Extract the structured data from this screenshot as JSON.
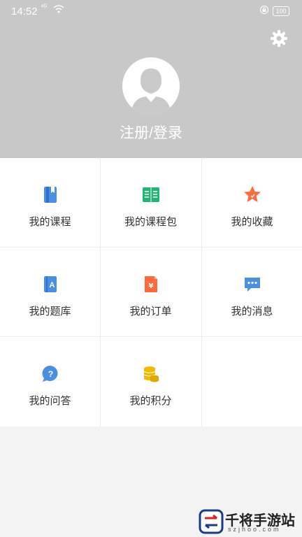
{
  "status": {
    "time": "14:52",
    "network": "⁴ᴳ",
    "battery": "100"
  },
  "header": {
    "login_text": "注册/登录"
  },
  "menu": [
    {
      "label": "我的课程",
      "icon": "book-icon",
      "color": "#4a90e2"
    },
    {
      "label": "我的课程包",
      "icon": "open-book-icon",
      "color": "#21b573"
    },
    {
      "label": "我的收藏",
      "icon": "star-icon",
      "color": "#ff6a3d"
    },
    {
      "label": "我的题库",
      "icon": "question-bank-icon",
      "color": "#4a90e2"
    },
    {
      "label": "我的订单",
      "icon": "order-icon",
      "color": "#ff6a3d"
    },
    {
      "label": "我的消息",
      "icon": "message-icon",
      "color": "#4a90e2"
    },
    {
      "label": "我的问答",
      "icon": "qa-icon",
      "color": "#4a90e2"
    },
    {
      "label": "我的积分",
      "icon": "coins-icon",
      "color": "#f5b800"
    }
  ],
  "watermark": {
    "text": "千将手游站",
    "sub": "szjhoo.com"
  }
}
